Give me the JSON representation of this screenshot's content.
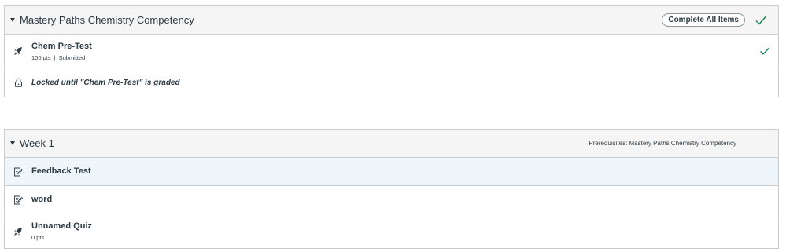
{
  "modules": [
    {
      "title": "Mastery Paths Chemistry Competency",
      "requirement_label": "Complete All Items",
      "items": [
        {
          "title": "Chem Pre-Test",
          "points": "100 pts",
          "separator": "|",
          "status": "Submitted",
          "icon": "quiz-rocket-icon"
        },
        {
          "locked_text": "Locked until \"Chem Pre-Test\" is graded",
          "icon": "lock-icon"
        }
      ]
    },
    {
      "title": "Week 1",
      "prerequisites": "Prerequisites: Mastery Paths Chemistry Competency",
      "items": [
        {
          "title": "Feedback Test",
          "icon": "assignment-icon"
        },
        {
          "title": "word",
          "icon": "assignment-icon"
        },
        {
          "title": "Unnamed Quiz",
          "points": "0 pts",
          "icon": "quiz-rocket-icon"
        }
      ]
    }
  ],
  "colors": {
    "header_bg": "#f5f5f5",
    "border": "#c7cdd1",
    "check_green": "#0b874b",
    "highlight_bg": "#eef6fc",
    "text": "#2d3b45"
  }
}
